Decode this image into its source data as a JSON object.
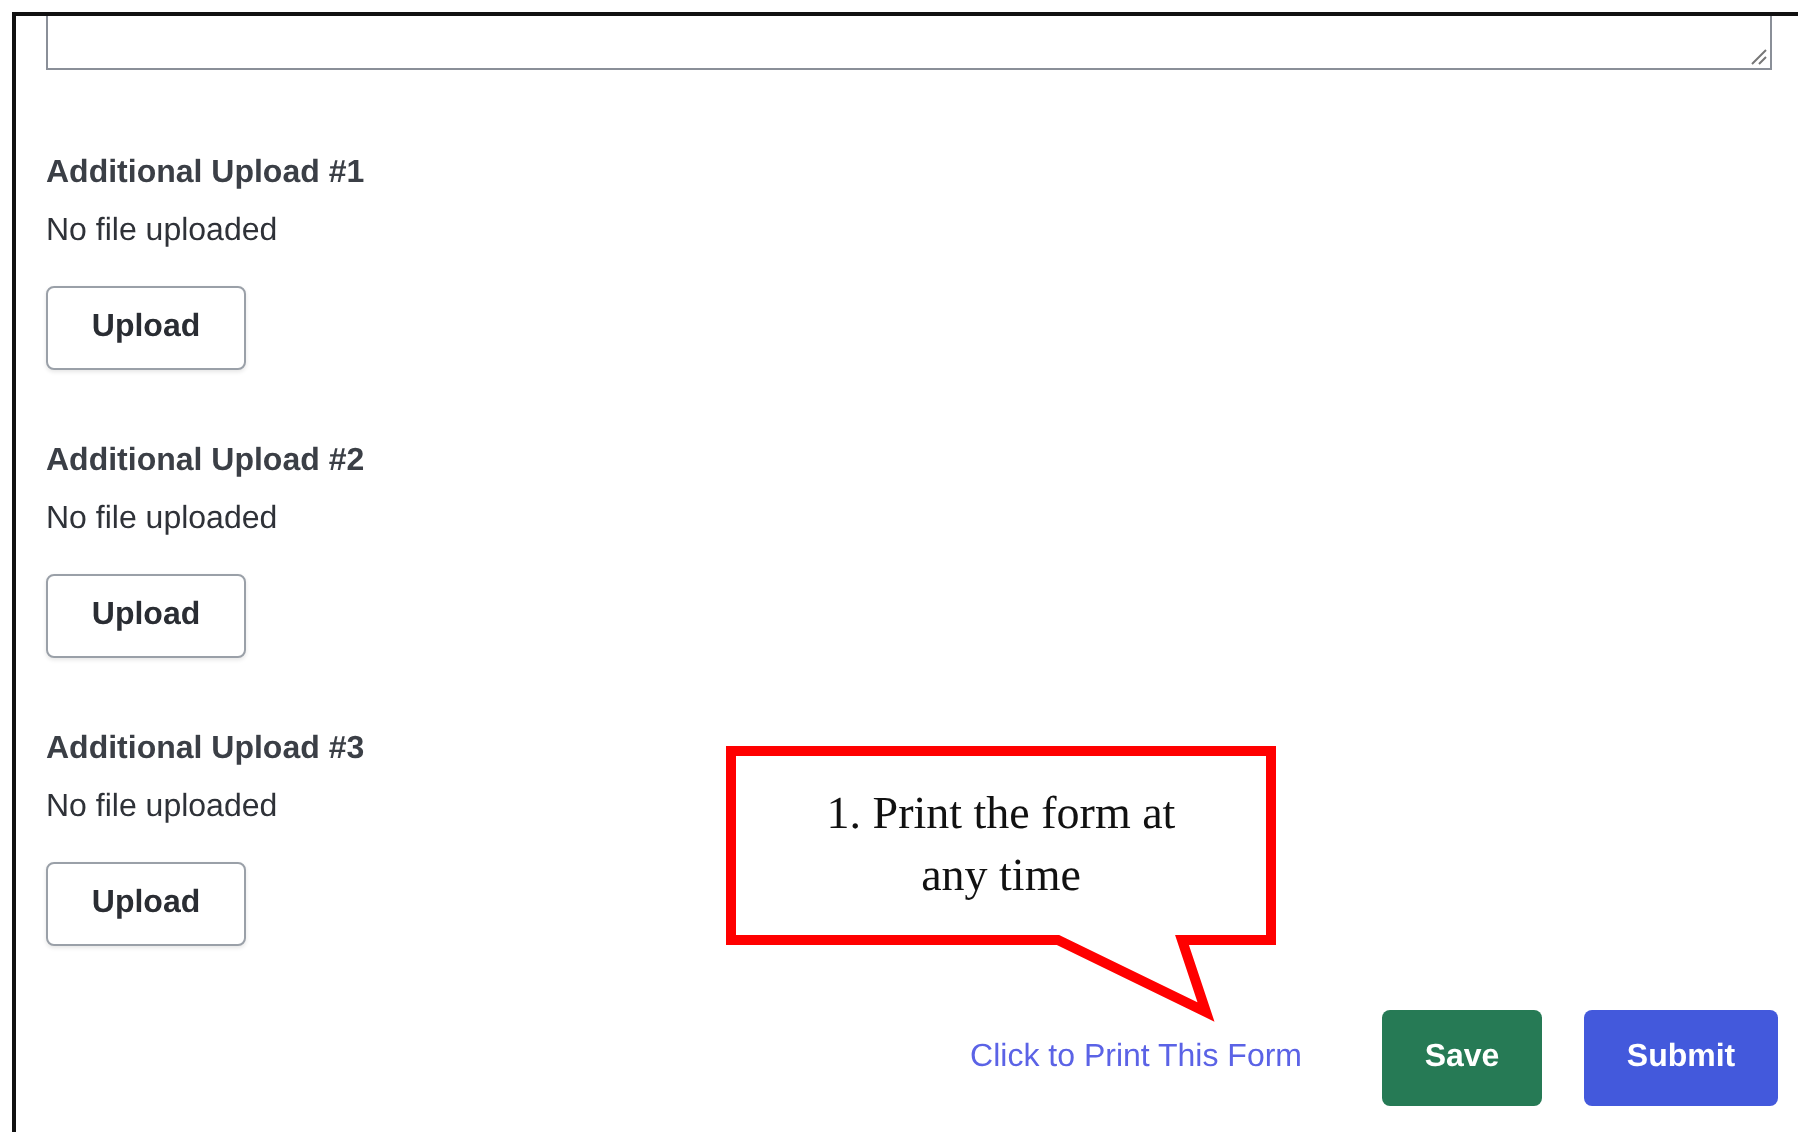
{
  "uploads": [
    {
      "label": "Additional Upload #1",
      "status": "No file uploaded",
      "button": "Upload"
    },
    {
      "label": "Additional Upload #2",
      "status": "No file uploaded",
      "button": "Upload"
    },
    {
      "label": "Additional Upload #3",
      "status": "No file uploaded",
      "button": "Upload"
    }
  ],
  "print_link": "Click to Print This Form",
  "buttons": [
    {
      "label": "Save",
      "kind": "save"
    },
    {
      "label": "Submit",
      "kind": "submit"
    }
  ],
  "callout": {
    "text": "1. Print the form at any time"
  }
}
